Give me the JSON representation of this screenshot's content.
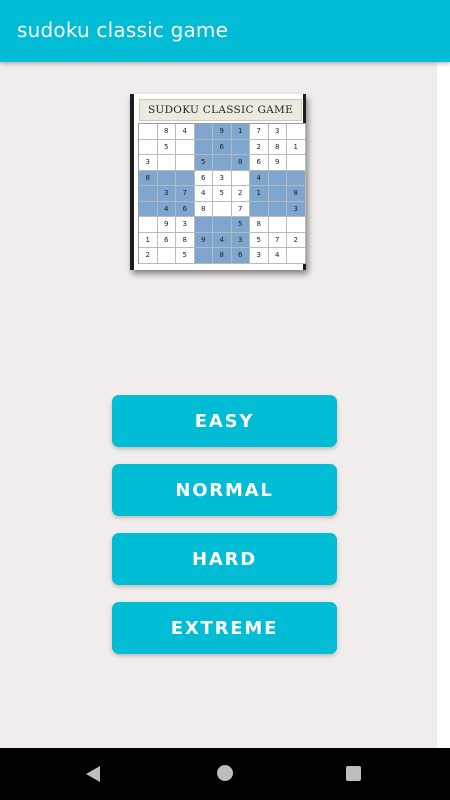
{
  "app_bar": {
    "title": "sudoku classic game"
  },
  "puzzle": {
    "title": "SUDOKU CLASSIC GAME",
    "cells": [
      [
        "",
        "8",
        "4",
        "",
        "9",
        "1",
        "7",
        "3",
        ""
      ],
      [
        "",
        "5",
        "",
        "",
        "6",
        "",
        "2",
        "8",
        "1"
      ],
      [
        "3",
        "",
        "",
        "5",
        "",
        "8",
        "6",
        "9",
        ""
      ],
      [
        "8",
        "",
        "",
        "6",
        "3",
        "",
        "4",
        "",
        ""
      ],
      [
        "",
        "3",
        "7",
        "4",
        "5",
        "2",
        "1",
        "",
        "8"
      ],
      [
        "",
        "4",
        "6",
        "8",
        "",
        "7",
        "",
        "",
        "3"
      ],
      [
        "",
        "9",
        "3",
        "",
        "",
        "5",
        "8",
        "",
        ""
      ],
      [
        "1",
        "6",
        "8",
        "9",
        "4",
        "3",
        "5",
        "7",
        "2"
      ],
      [
        "2",
        "",
        "5",
        "",
        "8",
        "6",
        "3",
        "4",
        ""
      ]
    ],
    "shaded_box_color": "#7ea6cf"
  },
  "difficulty": [
    {
      "label": "EASY"
    },
    {
      "label": "NORMAL"
    },
    {
      "label": "HARD"
    },
    {
      "label": "EXTREME"
    }
  ],
  "colors": {
    "accent": "#00bcd4",
    "background": "#f1eded"
  },
  "nav": {
    "back_icon": "back-triangle-icon",
    "home_icon": "home-circle-icon",
    "recents_icon": "recents-square-icon"
  }
}
